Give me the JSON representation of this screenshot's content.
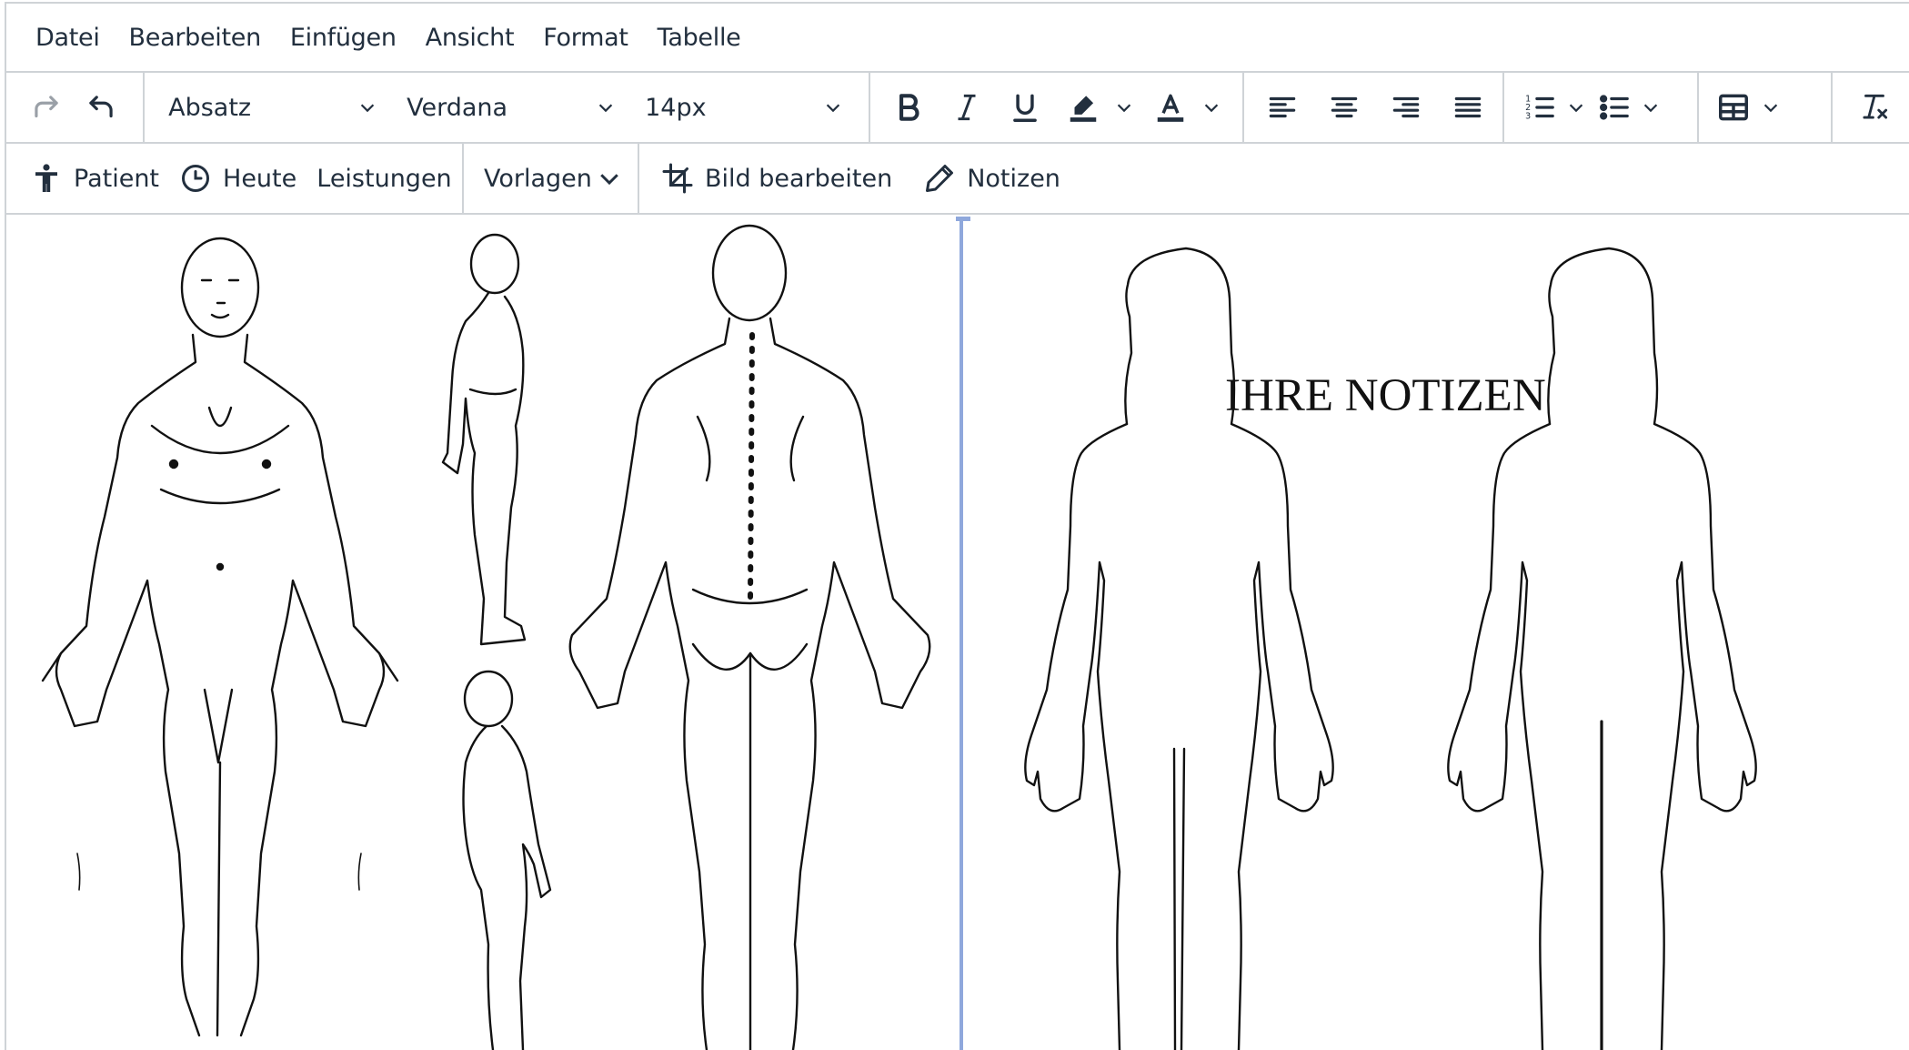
{
  "menubar": {
    "items": [
      "Datei",
      "Bearbeiten",
      "Einfügen",
      "Ansicht",
      "Format",
      "Tabelle"
    ]
  },
  "toolbar": {
    "block_format": "Absatz",
    "font_family": "Verdana",
    "font_size": "14px"
  },
  "custom_toolbar": {
    "patient_label": "Patient",
    "today_label": "Heute",
    "services_label": "Leistungen",
    "templates_label": "Vorlagen",
    "edit_image_label": "Bild bearbeiten",
    "notes_label": "Notizen"
  },
  "content": {
    "notes_heading": "IHRE NOTIZEN"
  },
  "colors": {
    "text": "#222f3e",
    "border": "#cfd3d7",
    "resize_handle": "#8fa8dc"
  }
}
